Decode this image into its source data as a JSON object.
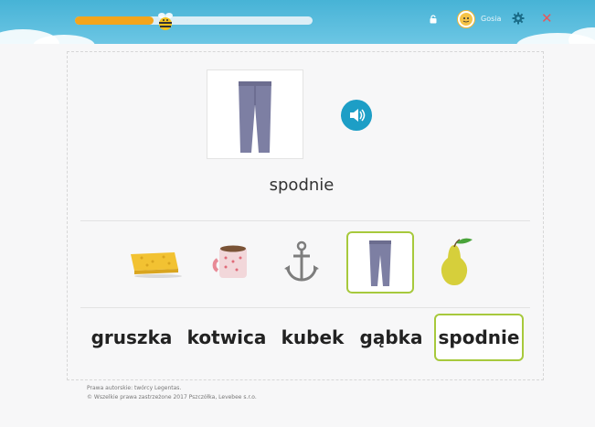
{
  "header": {
    "progress": 0.33,
    "username": "Gosia",
    "icons": [
      "bee-icon",
      "lock-icon",
      "avatar-icon",
      "gear-icon",
      "close-icon"
    ]
  },
  "exercise": {
    "word": "spodnie",
    "image": "pants-icon",
    "pictures": [
      "sponge-icon",
      "mug-icon",
      "anchor-icon",
      "pants-icon",
      "pear-icon"
    ],
    "selected_picture": "pants-icon",
    "choices": [
      "gruszka",
      "kotwica",
      "kubek",
      "gąbka",
      "spodnie"
    ],
    "selected_choice": "spodnie"
  },
  "footer": {
    "line1": "Prawa autorskie: twórcy Legentas.",
    "line2": "© Wszelkie prawa zastrzeżone 2017 Pszczółka, Levebee s.r.o."
  },
  "colors": {
    "header": "#55bbdd",
    "progress": "#f3a51c",
    "accent": "#a7c93c",
    "speaker": "#1d9ec6",
    "close": "#e8585b"
  }
}
